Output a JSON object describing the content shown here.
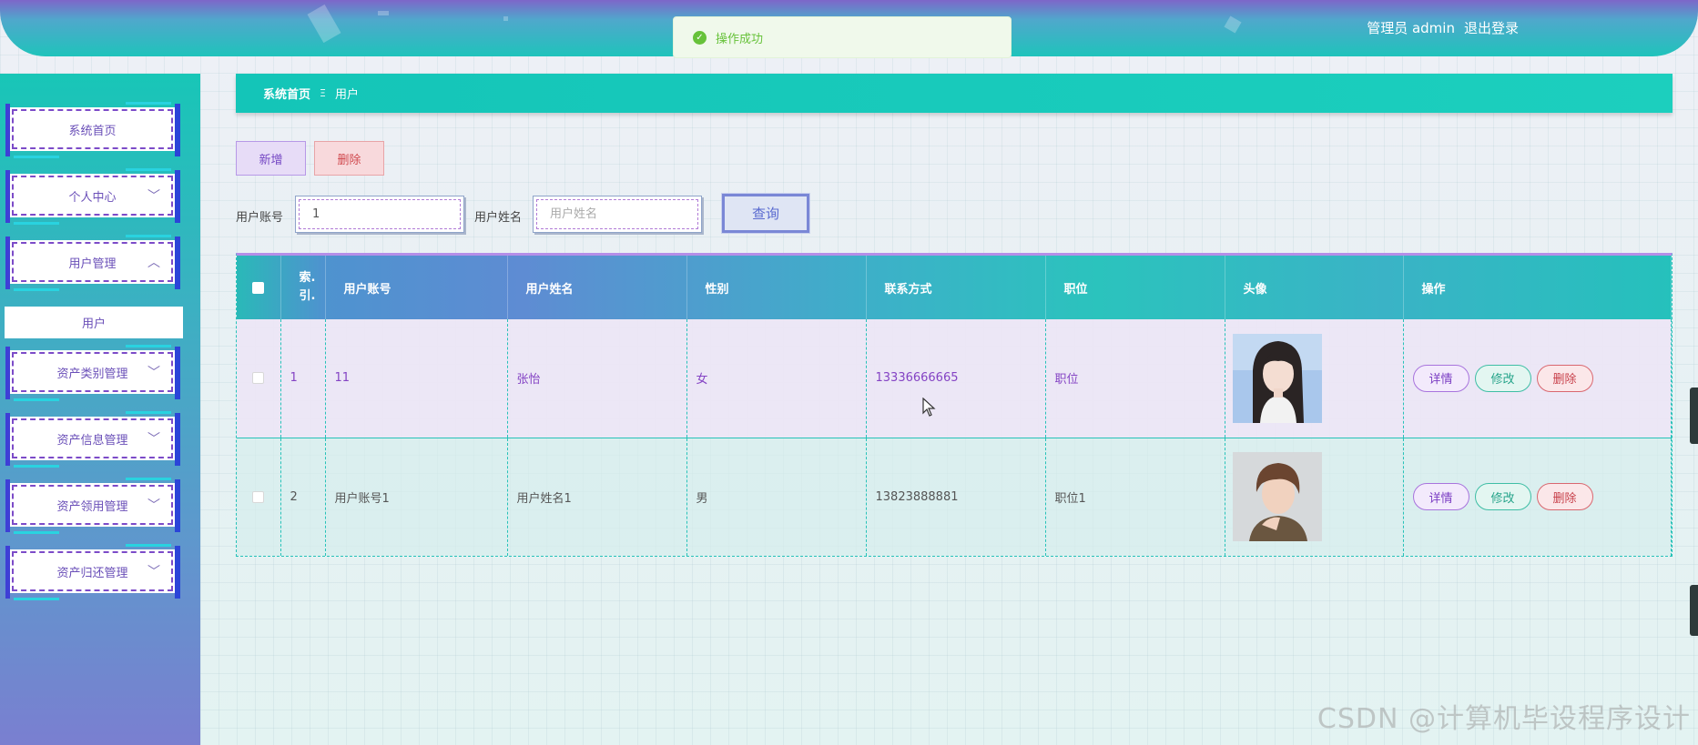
{
  "header": {
    "user_label": "管理员 admin",
    "logout_label": "退出登录"
  },
  "toast": {
    "message": "操作成功",
    "icon": "check-circle-icon"
  },
  "sidebar": {
    "items": [
      {
        "label": "系统首页",
        "chevron": ""
      },
      {
        "label": "个人中心",
        "chevron": "﹀"
      },
      {
        "label": "用户管理",
        "chevron": "︿"
      },
      {
        "label": "资产类别管理",
        "chevron": "﹀"
      },
      {
        "label": "资产信息管理",
        "chevron": "﹀"
      },
      {
        "label": "资产领用管理",
        "chevron": "﹀"
      },
      {
        "label": "资产归还管理",
        "chevron": "﹀"
      }
    ],
    "sub_item": "用户"
  },
  "breadcrumb": {
    "home": "系统首页",
    "separator": "Ξ",
    "current": "用户"
  },
  "actions": {
    "add_label": "新增",
    "delete_label": "删除"
  },
  "search": {
    "account_label": "用户账号",
    "account_value": "1",
    "name_label": "用户姓名",
    "name_placeholder": "用户姓名",
    "query_label": "查询"
  },
  "table": {
    "headers": [
      "索引",
      "用户账号",
      "用户姓名",
      "性别",
      "联系方式",
      "职位",
      "头像",
      "操作"
    ],
    "index_header_top": "索.",
    "index_header_bottom": "引.",
    "rows": [
      {
        "index": "1",
        "account": "11",
        "name": "张怡",
        "gender": "女",
        "phone": "13336666665",
        "position": "职位",
        "avatar": "female-avatar"
      },
      {
        "index": "2",
        "account": "用户账号1",
        "name": "用户姓名1",
        "gender": "男",
        "phone": "13823888881",
        "position": "职位1",
        "avatar": "male-avatar"
      }
    ],
    "ops": {
      "detail": "详情",
      "edit": "修改",
      "delete": "删除"
    }
  },
  "watermark": "CSDN @计算机毕设程序设计",
  "colors": {
    "accent_teal": "#1cc8bc",
    "accent_purple": "#7d67c9",
    "success": "#67c23a",
    "danger": "#d04a4f"
  }
}
